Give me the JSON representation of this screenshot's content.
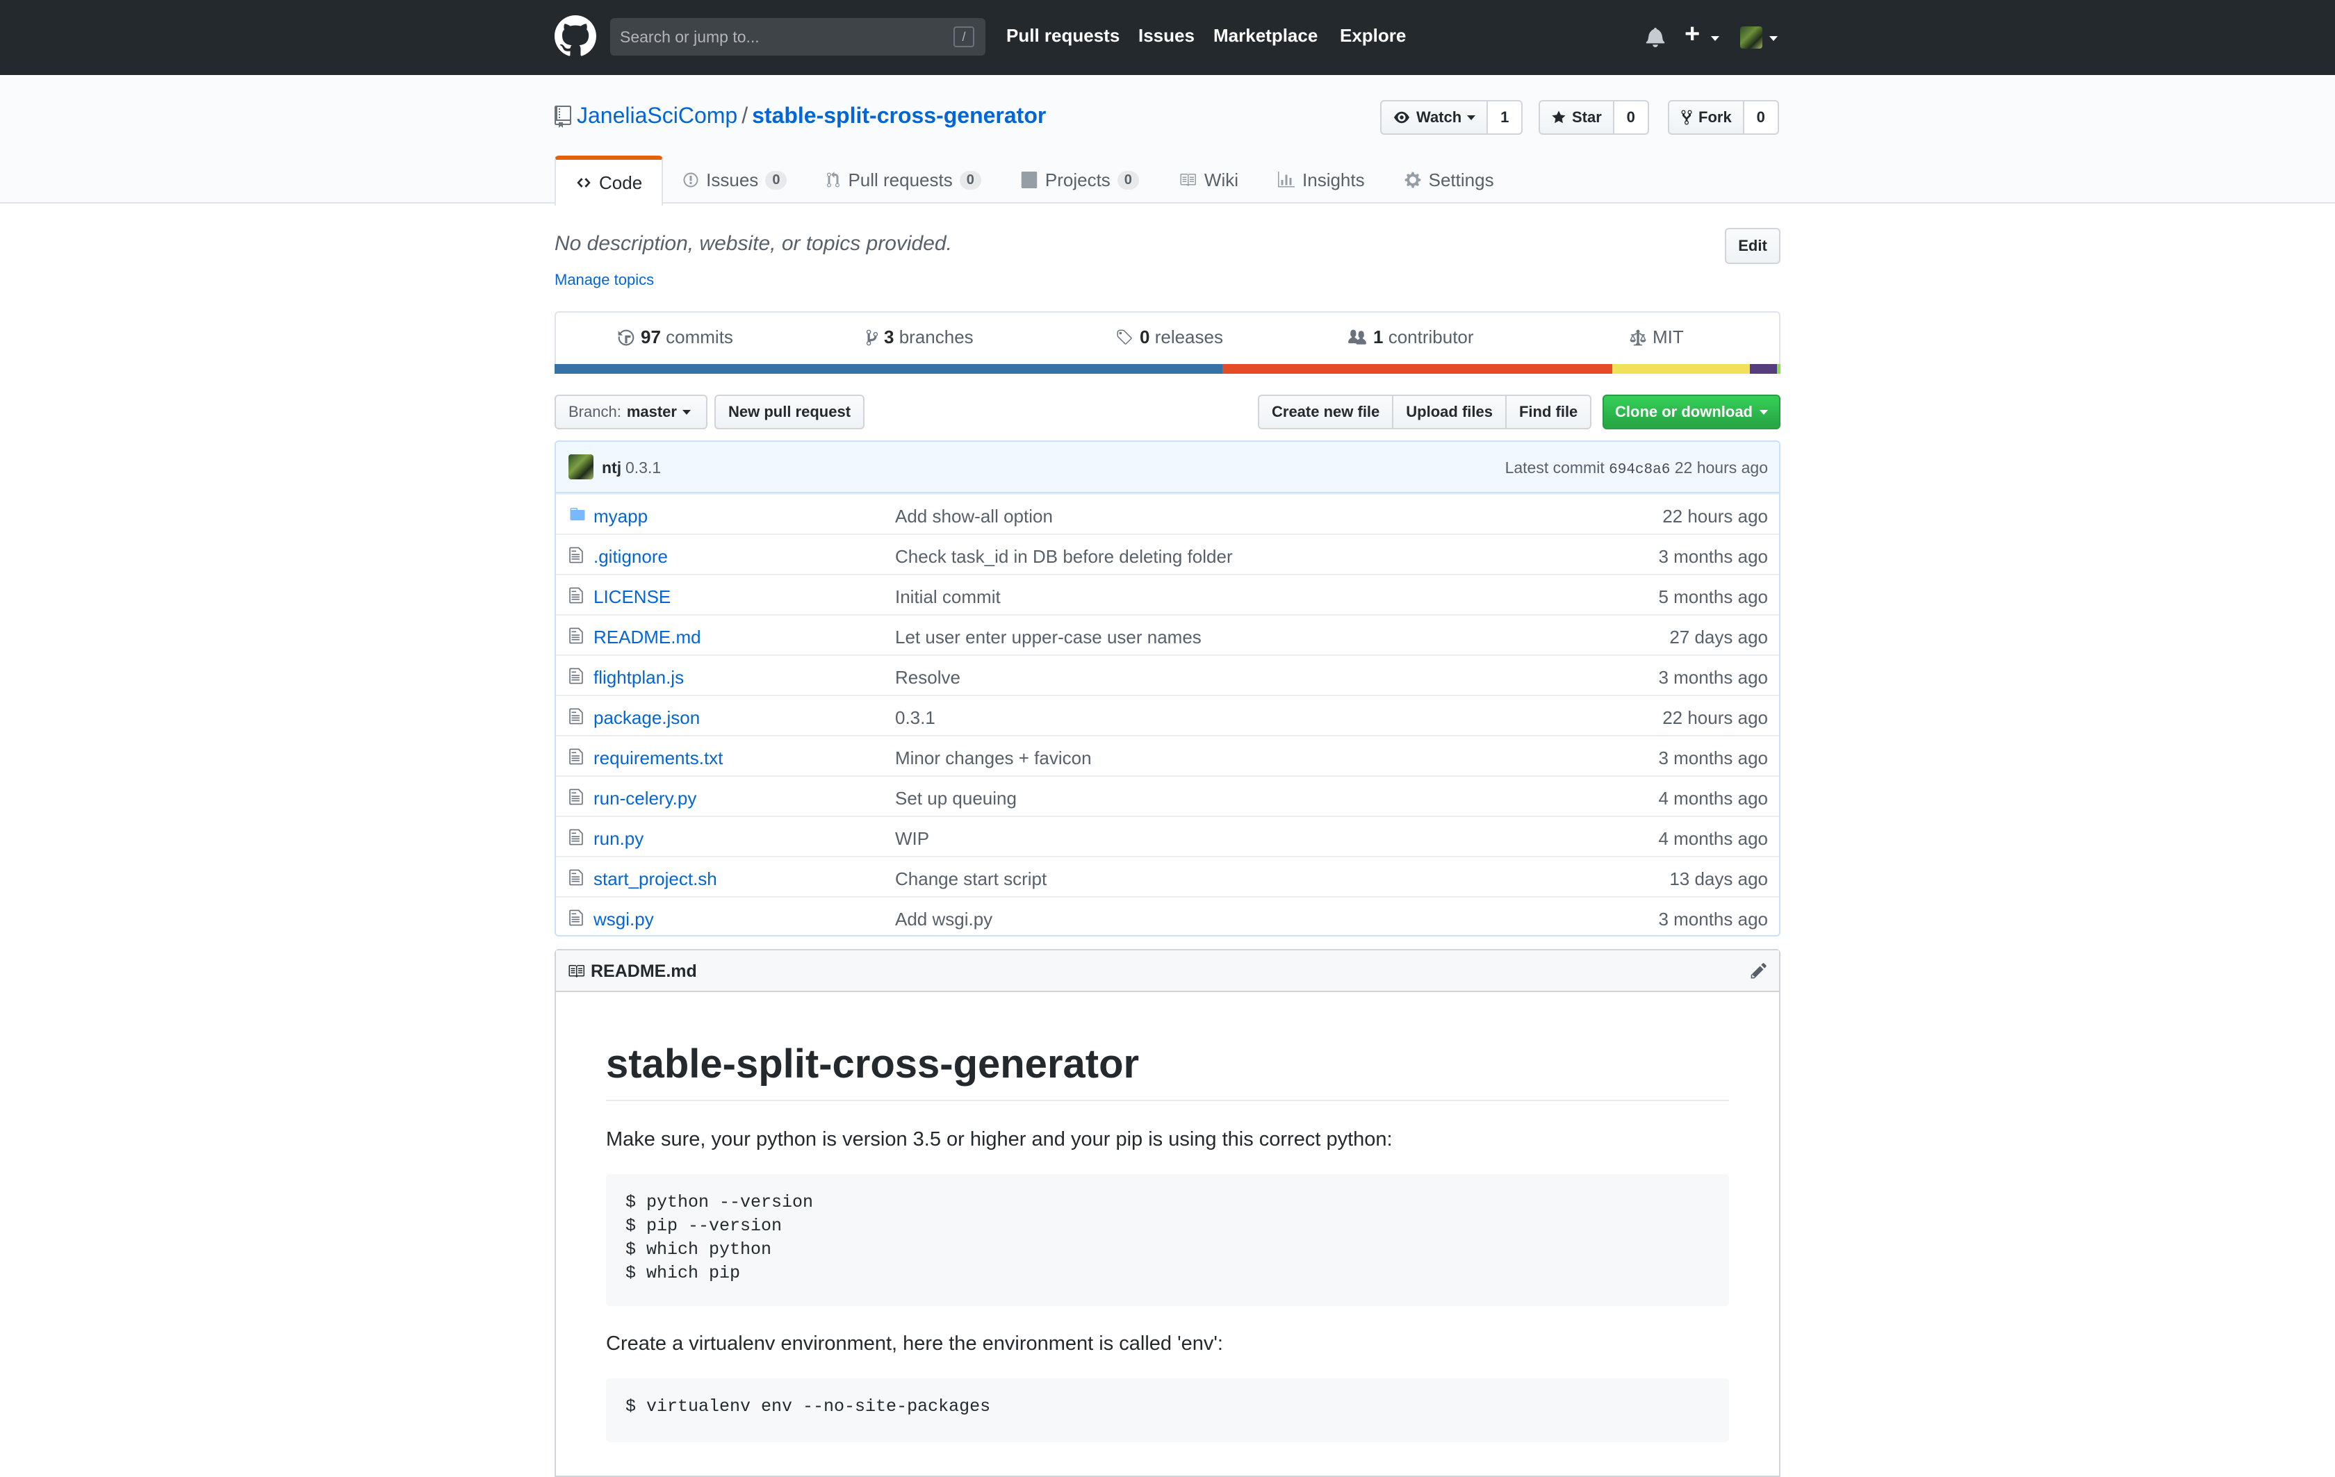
{
  "header": {
    "search_placeholder": "Search or jump to...",
    "search_key": "/",
    "nav": [
      "Pull requests",
      "Issues",
      "Marketplace",
      "Explore"
    ]
  },
  "repo": {
    "owner": "JaneliaSciComp",
    "separator": "/",
    "name": "stable-split-cross-generator",
    "watch_label": "Watch",
    "watch_count": "1",
    "star_label": "Star",
    "star_count": "0",
    "fork_label": "Fork",
    "fork_count": "0"
  },
  "tabs": [
    {
      "label": "Code"
    },
    {
      "label": "Issues",
      "count": "0"
    },
    {
      "label": "Pull requests",
      "count": "0"
    },
    {
      "label": "Projects",
      "count": "0"
    },
    {
      "label": "Wiki"
    },
    {
      "label": "Insights"
    },
    {
      "label": "Settings"
    }
  ],
  "description": {
    "text": "No description, website, or topics provided.",
    "edit_label": "Edit",
    "manage_topics": "Manage topics"
  },
  "summary": {
    "commits_n": "97",
    "commits_label": "commits",
    "branches_n": "3",
    "branches_label": "branches",
    "releases_n": "0",
    "releases_label": "releases",
    "contributors_n": "1",
    "contributors_label": "contributor",
    "license": "MIT"
  },
  "languages": [
    {
      "color": "#3572A5",
      "share": 0.545
    },
    {
      "color": "#e34c26",
      "share": 0.318
    },
    {
      "color": "#f1e05a",
      "share": 0.112
    },
    {
      "color": "#563d7c",
      "share": 0.022
    },
    {
      "color": "#89e051",
      "share": 0.003
    }
  ],
  "file_nav": {
    "branch_prefix": "Branch:",
    "branch": "master",
    "new_pr": "New pull request",
    "create_file": "Create new file",
    "upload": "Upload files",
    "find": "Find file",
    "clone": "Clone or download"
  },
  "latest_commit": {
    "user": "ntj",
    "message": "0.3.1",
    "prefix": "Latest commit",
    "sha": "694c8a6",
    "age": "22 hours ago"
  },
  "files": [
    {
      "name": "myapp",
      "type": "dir",
      "message": "Add show-all option",
      "age": "22 hours ago"
    },
    {
      "name": ".gitignore",
      "type": "file",
      "message": "Check task_id in DB before deleting folder",
      "age": "3 months ago"
    },
    {
      "name": "LICENSE",
      "type": "file",
      "message": "Initial commit",
      "age": "5 months ago"
    },
    {
      "name": "README.md",
      "type": "file",
      "message": "Let user enter upper-case user names",
      "age": "27 days ago"
    },
    {
      "name": "flightplan.js",
      "type": "file",
      "message": "Resolve",
      "age": "3 months ago"
    },
    {
      "name": "package.json",
      "type": "file",
      "message": "0.3.1",
      "age": "22 hours ago"
    },
    {
      "name": "requirements.txt",
      "type": "file",
      "message": "Minor changes + favicon",
      "age": "3 months ago"
    },
    {
      "name": "run-celery.py",
      "type": "file",
      "message": "Set up queuing",
      "age": "4 months ago"
    },
    {
      "name": "run.py",
      "type": "file",
      "message": "WIP",
      "age": "4 months ago"
    },
    {
      "name": "start_project.sh",
      "type": "file",
      "message": "Change start script",
      "age": "13 days ago"
    },
    {
      "name": "wsgi.py",
      "type": "file",
      "message": "Add wsgi.py",
      "age": "3 months ago"
    }
  ],
  "readme": {
    "filename": "README.md",
    "h1": "stable-split-cross-generator",
    "p1": "Make sure, your python is version 3.5 or higher and your pip is using this correct python:",
    "code1": "$ python --version\n$ pip --version\n$ which python\n$ which pip",
    "p2": "Create a virtualenv environment, here the environment is called 'env':",
    "code2": "$ virtualenv env --no-site-packages"
  }
}
